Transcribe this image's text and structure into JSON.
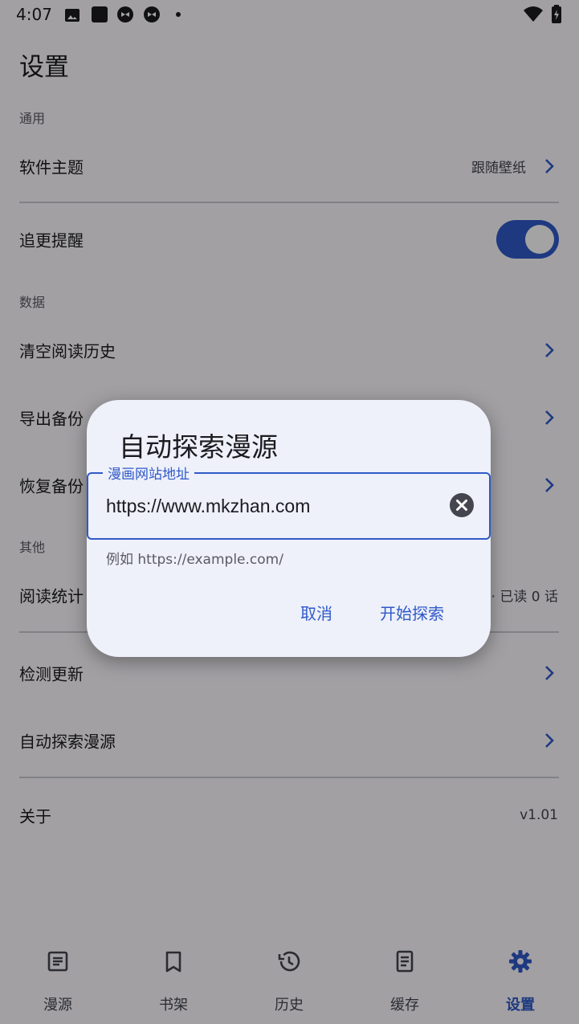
{
  "status_bar": {
    "time": "4:07"
  },
  "page": {
    "title": "设置"
  },
  "sections": {
    "general": "通用",
    "data": "数据",
    "other": "其他"
  },
  "rows": {
    "theme": {
      "label": "软件主题",
      "value": "跟随壁纸"
    },
    "update_reminder": {
      "label": "追更提醒",
      "enabled": true
    },
    "clear_history": {
      "label": "清空阅读历史"
    },
    "export_backup": {
      "label": "导出备份"
    },
    "restore_backup": {
      "label": "恢复备份"
    },
    "reading_stats": {
      "label": "阅读统计",
      "value": "· 已读 0 话"
    },
    "check_update": {
      "label": "检测更新"
    },
    "auto_discover": {
      "label": "自动探索漫源"
    },
    "about": {
      "label": "关于",
      "value": "v1.01"
    }
  },
  "dialog": {
    "title": "自动探索漫源",
    "field_label": "漫画网站地址",
    "field_value": "https://www.mkzhan.com",
    "helper": "例如 https://example.com/",
    "cancel": "取消",
    "confirm": "开始探索"
  },
  "nav": {
    "items": [
      {
        "label": "漫源",
        "icon": "article-icon"
      },
      {
        "label": "书架",
        "icon": "bookmark-icon"
      },
      {
        "label": "历史",
        "icon": "history-icon"
      },
      {
        "label": "缓存",
        "icon": "document-icon"
      },
      {
        "label": "设置",
        "icon": "gear-icon"
      }
    ],
    "active_index": 4
  },
  "colors": {
    "accent": "#2f5ac8",
    "dialog_bg": "#eef0fa",
    "scrim": "rgba(0,0,0,0.36)"
  }
}
